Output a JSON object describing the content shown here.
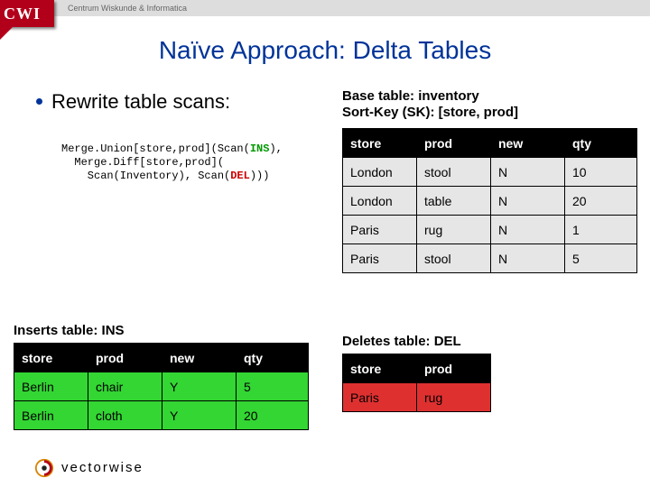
{
  "header": {
    "org_abbrev": "CWI",
    "org_full": "Centrum Wiskunde & Informatica"
  },
  "title": "Naïve Approach: Delta Tables",
  "bullet": "Rewrite table scans:",
  "code": {
    "l1a": "Merge.Union[store,prod](Scan(",
    "l1b": "INS",
    "l1c": "),",
    "l2": "  Merge.Diff[store,prod](",
    "l3a": "    Scan(Inventory), Scan(",
    "l3b": "DEL",
    "l3c": ")))"
  },
  "captions": {
    "base_l1": "Base table: inventory",
    "base_l2": "Sort-Key (SK): [store, prod]",
    "ins": "Inserts table: INS",
    "del": "Deletes table: DEL"
  },
  "tables": {
    "cols4": {
      "c0": "store",
      "c1": "prod",
      "c2": "new",
      "c3": "qty"
    },
    "cols2": {
      "c0": "store",
      "c1": "prod"
    },
    "base": {
      "r0": {
        "c0": "London",
        "c1": "stool",
        "c2": "N",
        "c3": "10"
      },
      "r1": {
        "c0": "London",
        "c1": "table",
        "c2": "N",
        "c3": "20"
      },
      "r2": {
        "c0": "Paris",
        "c1": "rug",
        "c2": "N",
        "c3": "1"
      },
      "r3": {
        "c0": "Paris",
        "c1": "stool",
        "c2": "N",
        "c3": "5"
      }
    },
    "ins": {
      "r0": {
        "c0": "Berlin",
        "c1": "chair",
        "c2": "Y",
        "c3": "5"
      },
      "r1": {
        "c0": "Berlin",
        "c1": "cloth",
        "c2": "Y",
        "c3": "20"
      }
    },
    "del": {
      "r0": {
        "c0": "Paris",
        "c1": "rug"
      }
    }
  },
  "footer": {
    "brand": "vectorwise"
  }
}
